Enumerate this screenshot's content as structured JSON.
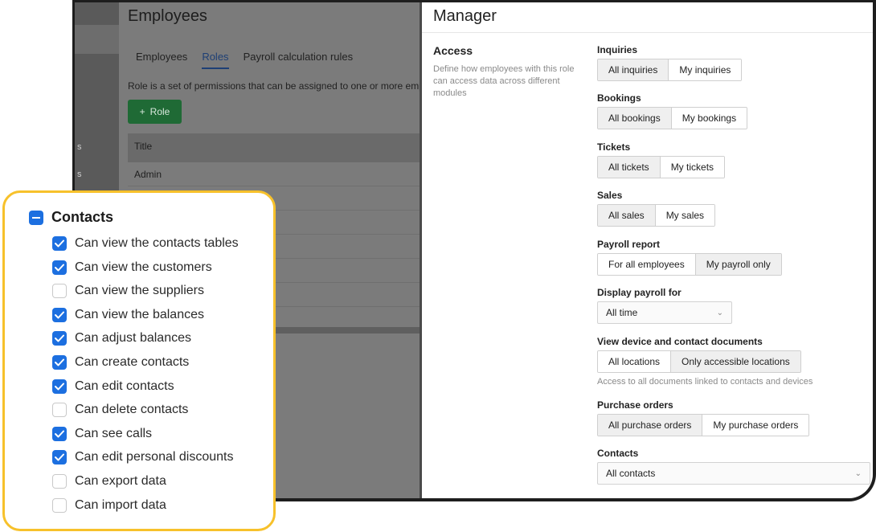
{
  "background_app": {
    "title": "Employees",
    "tabs": [
      "Employees",
      "Roles",
      "Payroll calculation rules"
    ],
    "active_tab": "Roles",
    "description": "Role is a set of permissions that can be assigned to one or more employ",
    "add_role_label": "Role",
    "table_header": "Title",
    "first_row": "Admin",
    "sidebar_letters": [
      "s",
      "s"
    ]
  },
  "panel": {
    "title": "Manager",
    "section_title": "Access",
    "section_desc": "Define how employees with this role can access data across different modules",
    "fields": {
      "inquiries": {
        "label": "Inquiries",
        "options": [
          "All inquiries",
          "My inquiries"
        ],
        "selected": "All inquiries"
      },
      "bookings": {
        "label": "Bookings",
        "options": [
          "All bookings",
          "My bookings"
        ],
        "selected": "All bookings"
      },
      "tickets": {
        "label": "Tickets",
        "options": [
          "All tickets",
          "My tickets"
        ],
        "selected": "All tickets"
      },
      "sales": {
        "label": "Sales",
        "options": [
          "All sales",
          "My sales"
        ],
        "selected": "All sales"
      },
      "payroll_report": {
        "label": "Payroll report",
        "options": [
          "For all employees",
          "My payroll only"
        ],
        "selected": "My payroll only"
      },
      "display_payroll": {
        "label": "Display payroll for",
        "value": "All time"
      },
      "documents": {
        "label": "View device and contact documents",
        "options": [
          "All locations",
          "Only accessible locations"
        ],
        "selected": "Only accessible locations",
        "hint": "Access to all documents linked to contacts and devices"
      },
      "purchase_orders": {
        "label": "Purchase orders",
        "options": [
          "All purchase orders",
          "My purchase orders"
        ],
        "selected": "All purchase orders"
      },
      "contacts": {
        "label": "Contacts",
        "value": "All contacts"
      }
    }
  },
  "contacts_card": {
    "title": "Contacts",
    "permissions": [
      {
        "label": "Can view the contacts tables",
        "checked": true
      },
      {
        "label": "Can view the customers",
        "checked": true
      },
      {
        "label": "Can view the suppliers",
        "checked": false
      },
      {
        "label": "Can view the balances",
        "checked": true
      },
      {
        "label": "Can adjust balances",
        "checked": true
      },
      {
        "label": "Can create contacts",
        "checked": true
      },
      {
        "label": "Can edit contacts",
        "checked": true
      },
      {
        "label": "Can delete contacts",
        "checked": false
      },
      {
        "label": "Can see calls",
        "checked": true
      },
      {
        "label": "Can edit personal discounts",
        "checked": true
      },
      {
        "label": "Can export data",
        "checked": false
      },
      {
        "label": "Can import data",
        "checked": false
      }
    ]
  },
  "colors": {
    "accent": "#1c6fe0",
    "card_border": "#f7c12b",
    "green_button": "#1f6a35"
  }
}
